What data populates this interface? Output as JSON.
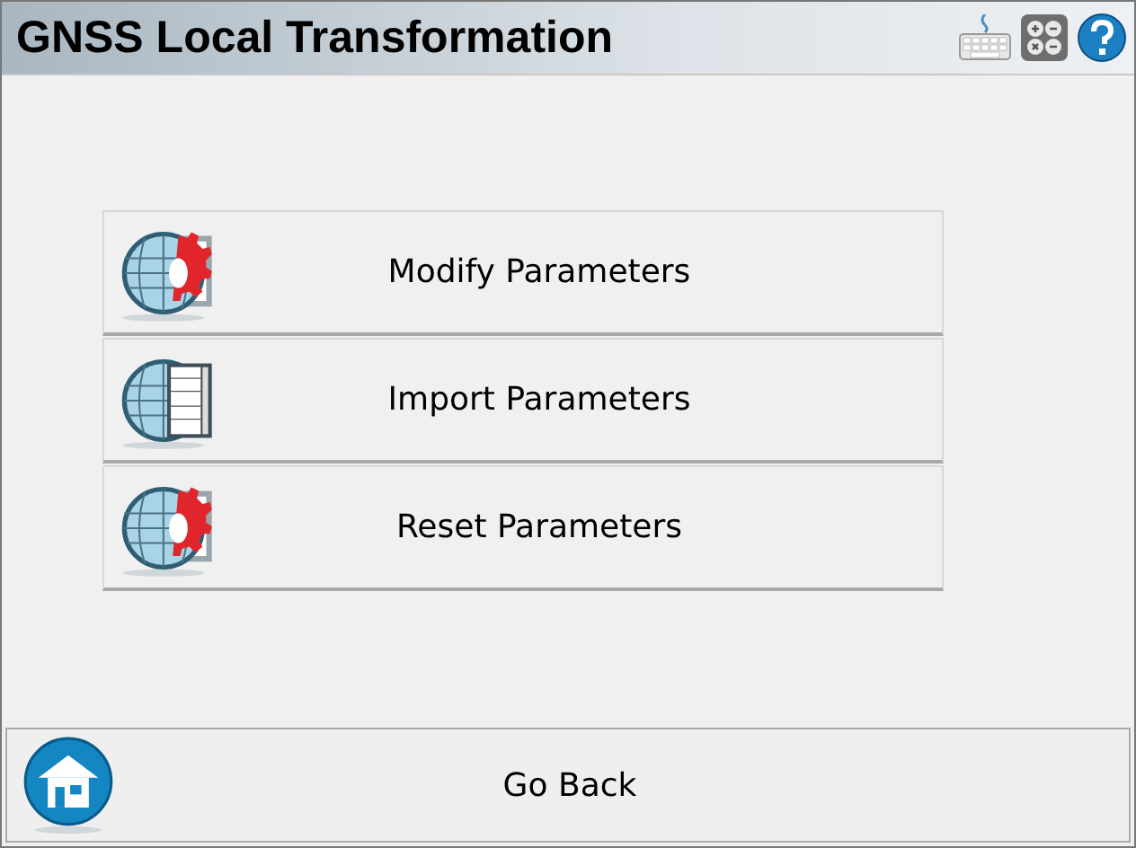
{
  "window": {
    "title": "GNSS Local Transformation"
  },
  "actions": [
    {
      "label": "Modify Parameters",
      "kind": "gear"
    },
    {
      "label": "Import Parameters",
      "kind": "table"
    },
    {
      "label": "Reset Parameters",
      "kind": "gear"
    }
  ],
  "footer": {
    "label": "Go Back"
  }
}
